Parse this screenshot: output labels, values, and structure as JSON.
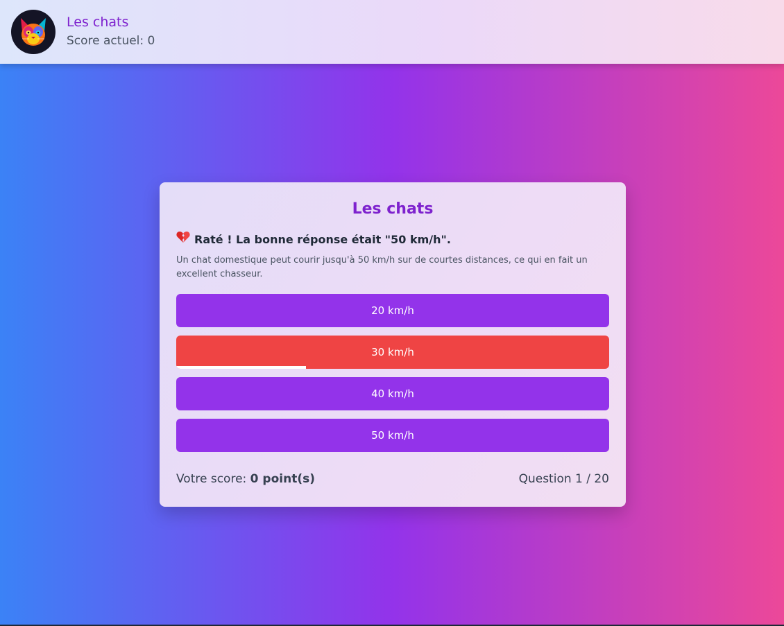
{
  "header": {
    "title": "Les chats",
    "score_text": "Score actuel: 0",
    "avatar_icon": "cat-icon"
  },
  "quiz": {
    "title": "Les chats",
    "feedback": "Raté ! La bonne réponse était \"50 km/h\".",
    "feedback_icon": "broken-heart-icon",
    "explanation": "Un chat domestique peut courir jusqu'à 50 km/h sur de courtes distances, ce qui en fait un excellent chasseur.",
    "answers": [
      {
        "label": "20 km/h",
        "state": "default"
      },
      {
        "label": "30 km/h",
        "state": "wrong"
      },
      {
        "label": "40 km/h",
        "state": "default"
      },
      {
        "label": "50 km/h",
        "state": "default"
      }
    ],
    "timer_progress": 0.3,
    "score_label": "Votre score: ",
    "score_value": "0 point(s)",
    "question_counter": "Question 1 / 20"
  },
  "colors": {
    "accent": "#9333ea",
    "wrong": "#ef4444",
    "title": "#7e22ce"
  }
}
